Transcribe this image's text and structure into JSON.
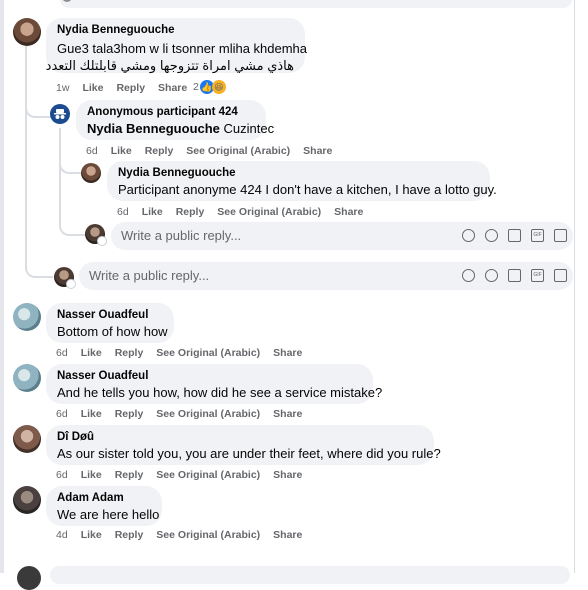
{
  "c1": {
    "author": "Nydia Benneguouche",
    "line1": "Gue3 tala3hom w li tsonner mliha khdemha",
    "line2": "هاذي مشي امراة تتزوجها ومشي قابلتلك التعدد",
    "time": "1w",
    "like": "Like",
    "reply": "Reply",
    "share": "Share",
    "reactions": "2"
  },
  "r1": {
    "author": "Anonymous participant 424",
    "mention": "Nydia Benneguouche",
    "text": "Cuzintec",
    "time": "6d",
    "like": "Like",
    "reply": "Reply",
    "see_original": "See Original (Arabic)",
    "share": "Share"
  },
  "r2": {
    "author": "Nydia Benneguouche",
    "text": "Participant anonyme 424 I don't have a kitchen, I have a lotto guy.",
    "time": "6d",
    "like": "Like",
    "reply": "Reply",
    "see_original": "See Original (Arabic)",
    "share": "Share"
  },
  "reply_inner": {
    "placeholder": "Write a public reply..."
  },
  "reply_outer": {
    "placeholder": "Write a public reply..."
  },
  "c2": {
    "author": "Nasser Ouadfeul",
    "text": "Bottom of how how",
    "time": "6d",
    "like": "Like",
    "reply": "Reply",
    "see_original": "See Original (Arabic)",
    "share": "Share"
  },
  "c3": {
    "author": "Nasser Ouadfeul",
    "text": "And he tells you how, how did he see a service mistake?",
    "time": "6d",
    "like": "Like",
    "reply": "Reply",
    "see_original": "See Original (Arabic)",
    "share": "Share"
  },
  "c4": {
    "author": "Dî Døû",
    "text": "As our sister told you, you are under their feet, where did you rule?",
    "time": "6d",
    "like": "Like",
    "reply": "Reply",
    "see_original": "See Original (Arabic)",
    "share": "Share"
  },
  "c5": {
    "author": "Adam Adam",
    "text": "We are here hello",
    "time": "4d",
    "like": "Like",
    "reply": "Reply",
    "see_original": "See Original (Arabic)",
    "share": "Share"
  },
  "icons": {
    "gif": "GIF",
    "emoji": "emoji-icon",
    "camera": "camera-icon",
    "sticker": "sticker-icon",
    "avatar": "avatar-sticker-icon"
  },
  "colors": {
    "bubble": "#f0f2f5",
    "meta": "#65676b",
    "like_blue": "#1877f2",
    "anon_blue": "#1c4b8f"
  }
}
